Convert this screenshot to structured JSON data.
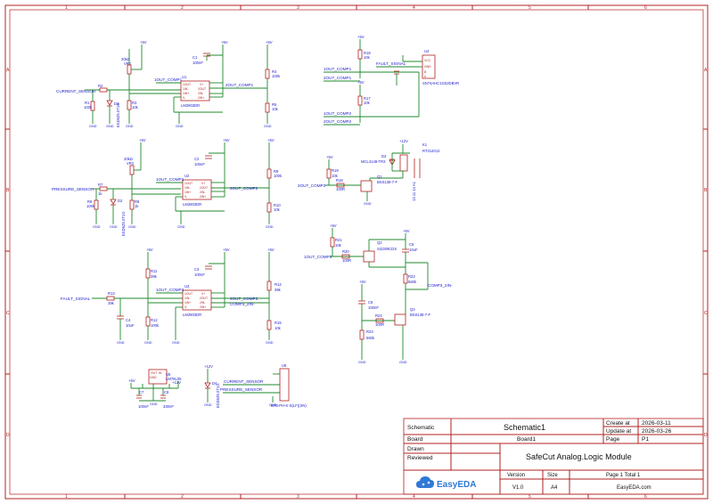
{
  "title_block": {
    "schematic_label": "Schematic",
    "schematic_name": "Schematic1",
    "create_at_label": "Create at",
    "create_at": "2026-03-11",
    "update_at_label": "Update at",
    "update_at": "2026-03-26",
    "board_label": "Board",
    "board_name": "Board1",
    "page_label": "Page",
    "page_no": "P1",
    "drawn_label": "Drawn",
    "reviewed_label": "Reviewed",
    "project": "SafeCut Analog.Logic Module",
    "version_label": "Version",
    "version": "V1.0",
    "size_label": "Size",
    "size": "A4",
    "page_total": "Page  1  Total  1",
    "brand": "EasyEDA",
    "brand_url": "EasyEDA.com"
  },
  "zones": {
    "columns": [
      "1",
      "2",
      "3",
      "4",
      "5",
      "6"
    ],
    "rows": [
      "A",
      "B",
      "C",
      "D"
    ]
  },
  "power": {
    "vcc": "+5V",
    "vcc12": "+12V",
    "gnd": "GND"
  },
  "nets": {
    "current_sensor": "CURRENT_SENSOR",
    "pressure_sensor": "PRESSURE_SENSOR",
    "fault_signal": "FAULT_SIGNAL",
    "out1_comp1": "1OUT_COMP1",
    "out2_comp1": "2OUT_COMP1",
    "out1_comp2": "1OUT_COMP2",
    "out2_comp2": "2OUT_COMP2",
    "out1_comp3": "1OUT_COMP3",
    "out2_comp3": "2OUT_COMP3",
    "comp3_2in": "COMP3_2IN-"
  },
  "parts": {
    "vr1_val": "20kΩ",
    "vr1": "VR1",
    "vr2_val": "20kΩ",
    "vr2": "VR2",
    "u1": "U1",
    "u2": "U2",
    "u3": "U3",
    "lm2903": "LM2903DR",
    "r1": "R1",
    "r2": "R2",
    "r3": "R3",
    "r4": "R4",
    "r5": "R5",
    "r6": "R6",
    "r7": "R7",
    "r8": "R8",
    "r9": "R9",
    "r10": "R10",
    "r11": "R11",
    "r12": "R12",
    "r13": "R13",
    "r14": "R14",
    "r15": "R15",
    "r16": "R16",
    "r17": "R17",
    "r18": "R18",
    "r19": "R19",
    "r20": "R20",
    "r21": "R21",
    "r22": "R22",
    "r23": "R23",
    "r24": "R24",
    "v10k": "10k",
    "v100k": "100k",
    "v1k": "1k",
    "v39k": "39k",
    "v100r": "100R",
    "v560k": "560k",
    "c1": "C1",
    "c2": "C2",
    "c3": "C3",
    "c4": "C4",
    "c5": "C5",
    "c6": "C6",
    "c7": "C7",
    "c8": "C8",
    "v100nf": "100nF",
    "v10uf": "10uF",
    "v330nf": "330nF",
    "d1": "D1",
    "d2": "D2",
    "d3": "D3",
    "d4": "D4",
    "pesd": "ESD5Z5.0T1G",
    "q1": "Q1",
    "q1_val": "BSS138-7-F",
    "q2": "Q2",
    "q2_val": "SI2309CDS",
    "q3": "Q3",
    "q3_val": "BSS138-7-F",
    "u4": "U4",
    "u4_val": "SN74AHC1G02DBVR",
    "u4_a": "A",
    "u4_b": "B",
    "u4_y": "Y",
    "u4_vcc": "VCC",
    "u4_gnd": "GND",
    "u5": "U5",
    "u5_val": "LM78L05",
    "u6": "U6",
    "u6_val": "B7B-PH-K-S(LF)(SN)",
    "k1": "K1",
    "k1_val": "RT314012",
    "mcl": "MCL4148-TR3",
    "pin_out": "OUT",
    "pin_in": "IN",
    "pin_gnd": "GND",
    "pin_1out": "1OUT",
    "pin_1inm": "1IN-",
    "pin_1inp": "1IN+",
    "pin_vm": "V-",
    "pin_vp": "V+",
    "pin_2out": "2OUT",
    "pin_2inm": "2IN-",
    "pin_2inp": "2IN+",
    "k1_pins": "13 11 14 A1"
  }
}
